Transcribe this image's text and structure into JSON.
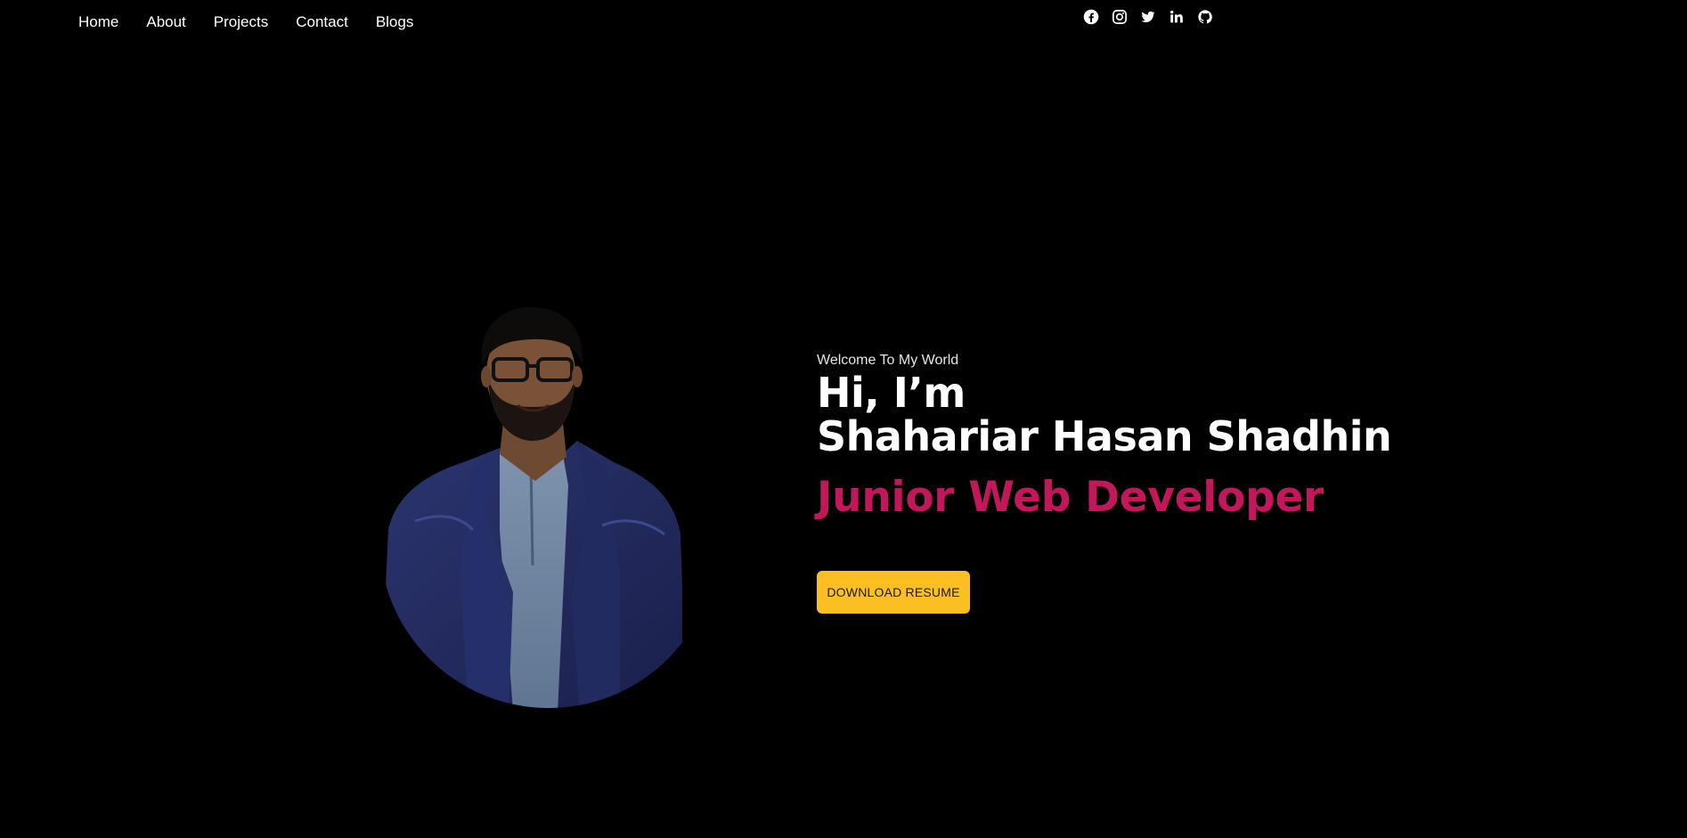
{
  "nav": {
    "links": [
      {
        "label": "Home"
      },
      {
        "label": "About"
      },
      {
        "label": "Projects"
      },
      {
        "label": "Contact"
      },
      {
        "label": "Blogs"
      }
    ],
    "socials": [
      {
        "icon": "facebook-icon"
      },
      {
        "icon": "instagram-icon"
      },
      {
        "icon": "twitter-icon"
      },
      {
        "icon": "linkedin-icon"
      },
      {
        "icon": "github-icon"
      }
    ]
  },
  "hero": {
    "welcome": "Welcome To My World",
    "greeting": "Hi, I’m",
    "name": "Shahariar Hasan Shadhin",
    "role": "Junior Web Developer",
    "resume_button": "DOWNLOAD RESUME",
    "avatar_icon": "profile-photo"
  },
  "colors": {
    "background": "#000000",
    "text": "#ffffff",
    "role_accent": "#c2185b",
    "button_bg": "#fbbf24"
  }
}
